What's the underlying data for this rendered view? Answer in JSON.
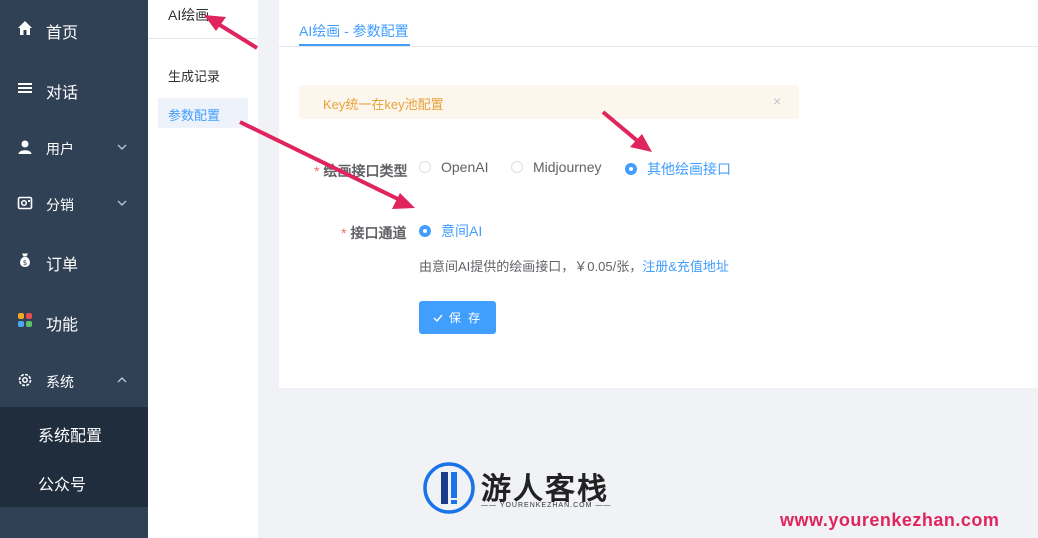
{
  "sidebar": {
    "items": [
      {
        "label": "首页",
        "icon": "home-icon"
      },
      {
        "label": "对话",
        "icon": "list-icon"
      },
      {
        "label": "用户",
        "icon": "user-icon"
      },
      {
        "label": "分销",
        "icon": "share-icon"
      },
      {
        "label": "订单",
        "icon": "money-bag-icon"
      },
      {
        "label": "功能",
        "icon": "apps-icon"
      },
      {
        "label": "系统",
        "icon": "gear-icon"
      }
    ],
    "submenu": [
      "系统配置",
      "公众号"
    ]
  },
  "secondary_menu": {
    "title": "AI绘画",
    "items": [
      "生成记录",
      "参数配置"
    ],
    "active": "参数配置"
  },
  "main": {
    "tab": "AI绘画 - 参数配置",
    "alert": {
      "text": "Key统一在key池配置",
      "close": "×"
    },
    "form": {
      "type_label": "绘画接口类型",
      "type_options": [
        "OpenAI",
        "Midjourney",
        "其他绘画接口"
      ],
      "type_selected": "其他绘画接口",
      "channel_label": "接口通道",
      "channel_options": [
        "意间AI"
      ],
      "channel_selected": "意间AI",
      "desc_text": "由意间AI提供的绘画接口，￥0.05/张，",
      "desc_link": "注册&充值地址",
      "required_mark": "*",
      "save_label": "保 存"
    }
  },
  "branding": {
    "logo_text": "游人客栈",
    "logo_sub": "—— YOURENKEZHAN.COM ——",
    "watermark": "www.yourenkezhan.com"
  },
  "colors": {
    "sidebar_bg": "#304156",
    "submenu_bg": "#1f2d3d",
    "primary": "#409eff",
    "warning": "#e6a23c",
    "arrow": "#e0245e"
  }
}
